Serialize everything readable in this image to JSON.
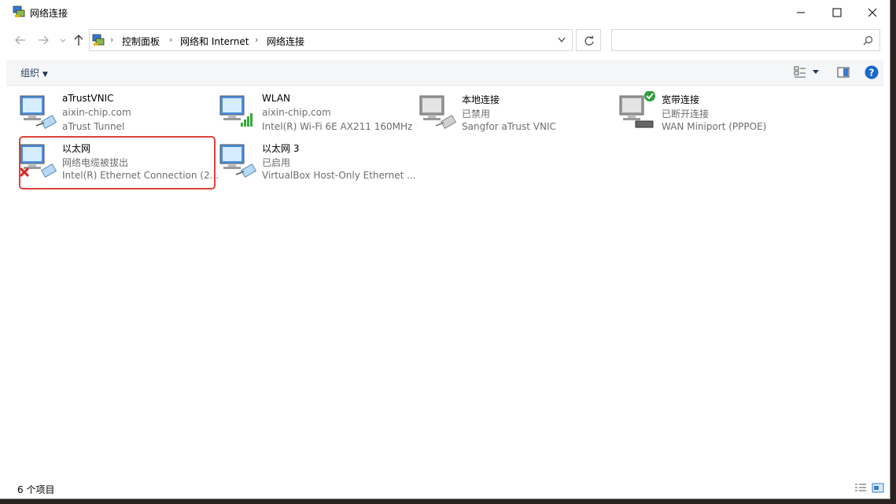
{
  "window": {
    "title": "网络连接",
    "icon": "network-connections-icon"
  },
  "titlebar_buttons": [
    "minimize-icon",
    "maximize-icon",
    "close-icon"
  ],
  "nav": {
    "back_icon": "arrow-left-icon",
    "forward_icon": "arrow-right-icon",
    "recent_icon": "chevron-down-icon",
    "up_icon": "arrow-up-icon"
  },
  "breadcrumb": {
    "items": [
      "控制面板",
      "网络和 Internet",
      "网络连接"
    ],
    "separator": "›"
  },
  "search": {
    "placeholder": "",
    "value": ""
  },
  "toolbar": {
    "organize_label": "组织",
    "accent": "#1e395b"
  },
  "connections": [
    {
      "name": "aTrustVNIC",
      "status": "aixin-chip.com",
      "device": "aTrust Tunnel",
      "state": "connected"
    },
    {
      "name": "WLAN",
      "status": "aixin-chip.com",
      "device": "Intel(R) Wi-Fi 6E AX211 160MHz",
      "state": "wifi"
    },
    {
      "name": "本地连接",
      "status": "已禁用",
      "device": "Sangfor aTrust VNIC",
      "state": "disabled"
    },
    {
      "name": "宽带连接",
      "status": "已断开连接",
      "device": "WAN Miniport (PPPOE)",
      "state": "broadband"
    },
    {
      "name": "以太网",
      "status": "网络电缆被拔出",
      "device": "Intel(R) Ethernet Connection (2...",
      "state": "unplugged"
    },
    {
      "name": "以太网 3",
      "status": "已启用",
      "device": "VirtualBox Host-Only Ethernet ...",
      "state": "connected"
    }
  ],
  "highlight_color": "#e0413b",
  "statusbar": {
    "count": "6 个项目"
  }
}
